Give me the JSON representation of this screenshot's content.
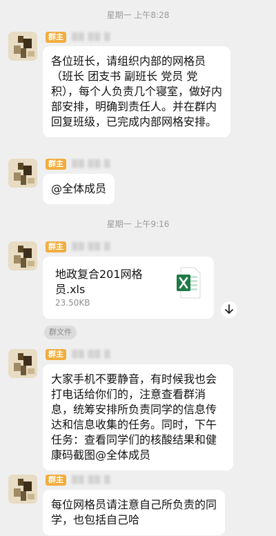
{
  "messages_area": {
    "time_1": "星期一 上午8:28",
    "time_2": "星期一 上午9:16",
    "role_badge": "群主",
    "msg_1": "各位班长，请组织内部的网格员（班长 团支书 副班长 党员 党积），每个人负责几个寝室，做好内部安排，明确到责任人。并在群内回复班级，已完成内部网格安排。",
    "msg_2": "@全体成员",
    "file": {
      "name": "地政复合201网格员.xls",
      "size": "23.50KB",
      "icon": "excel-file-icon"
    },
    "file_tag": "群文件",
    "msg_3": "大家手机不要静音，有时候我也会打电话给你们的，注意查看群消息，统筹安排所负责同学的信息传达和信息收集的任务。同时，下午任务：查看同学们的核酸结果和健康码截图@全体成员",
    "msg_4": "每位网格员请注意自己所负责的同学，也包括自己哈"
  },
  "colors": {
    "background": "#efefef",
    "bubble": "#ffffff",
    "role_badge": "#f1ad3d",
    "excel_green": "#1e7b45"
  }
}
